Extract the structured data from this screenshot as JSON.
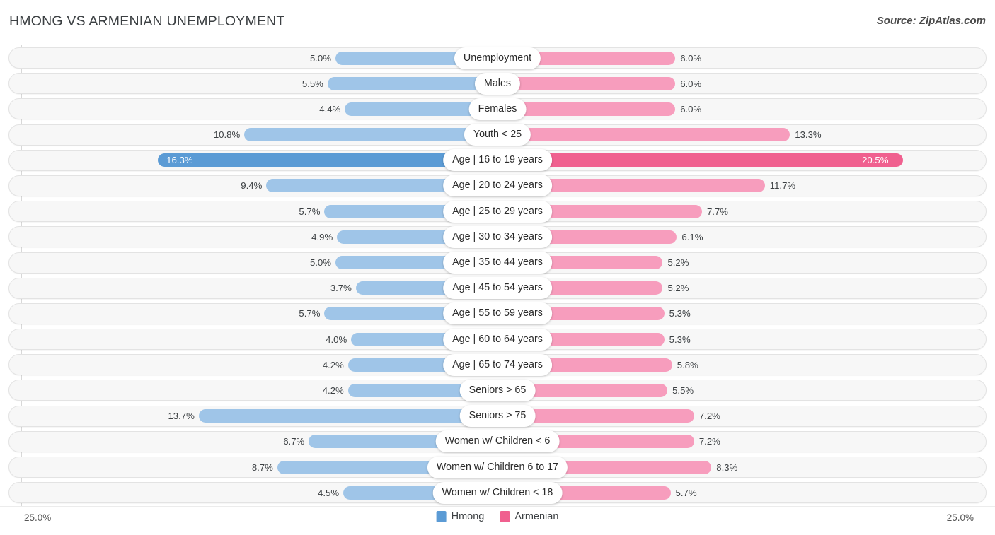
{
  "header": {
    "title": "HMONG VS ARMENIAN UNEMPLOYMENT",
    "source": "Source: ZipAtlas.com"
  },
  "legend": {
    "items": [
      {
        "label": "Hmong",
        "color": "#5b9bd5"
      },
      {
        "label": "Armenian",
        "color": "#f0608f"
      }
    ]
  },
  "axis": {
    "left_label": "25.0%",
    "right_label": "25.0%",
    "max": 25.0
  },
  "colors": {
    "hmong_light": "#9fc5e8",
    "hmong_dark": "#5b9bd5",
    "armenian_light": "#f79dbd",
    "armenian_dark": "#f0608f",
    "track": "#f7f7f7",
    "gridline": "#d8d8d8"
  },
  "chart_data": {
    "type": "bar",
    "orientation": "horizontal-diverging",
    "title": "HMONG VS ARMENIAN UNEMPLOYMENT",
    "xlabel": "",
    "ylabel": "",
    "xlim": [
      25.0,
      25.0
    ],
    "grid": true,
    "legend_position": "bottom-center",
    "categories": [
      "Unemployment",
      "Males",
      "Females",
      "Youth < 25",
      "Age | 16 to 19 years",
      "Age | 20 to 24 years",
      "Age | 25 to 29 years",
      "Age | 30 to 34 years",
      "Age | 35 to 44 years",
      "Age | 45 to 54 years",
      "Age | 55 to 59 years",
      "Age | 60 to 64 years",
      "Age | 65 to 74 years",
      "Seniors > 65",
      "Seniors > 75",
      "Women w/ Children < 6",
      "Women w/ Children 6 to 17",
      "Women w/ Children < 18"
    ],
    "series": [
      {
        "name": "Hmong",
        "side": "left",
        "values": [
          5.0,
          5.5,
          4.4,
          10.8,
          16.3,
          9.4,
          5.7,
          4.9,
          5.0,
          3.7,
          5.7,
          4.0,
          4.2,
          4.2,
          13.7,
          6.7,
          8.7,
          4.5
        ],
        "labels": [
          "5.0%",
          "5.5%",
          "4.4%",
          "10.8%",
          "16.3%",
          "9.4%",
          "5.7%",
          "4.9%",
          "5.0%",
          "3.7%",
          "5.7%",
          "4.0%",
          "4.2%",
          "4.2%",
          "13.7%",
          "6.7%",
          "8.7%",
          "4.5%"
        ]
      },
      {
        "name": "Armenian",
        "side": "right",
        "values": [
          6.0,
          6.0,
          6.0,
          13.3,
          20.5,
          11.7,
          7.7,
          6.1,
          5.2,
          5.2,
          5.3,
          5.3,
          5.8,
          5.5,
          7.2,
          7.2,
          8.3,
          5.7
        ],
        "labels": [
          "6.0%",
          "6.0%",
          "6.0%",
          "13.3%",
          "20.5%",
          "11.7%",
          "7.7%",
          "6.1%",
          "5.2%",
          "5.2%",
          "5.3%",
          "5.3%",
          "5.8%",
          "5.5%",
          "7.2%",
          "7.2%",
          "8.3%",
          "5.7%"
        ]
      }
    ],
    "highlighted_row": "Age | 16 to 19 years"
  }
}
